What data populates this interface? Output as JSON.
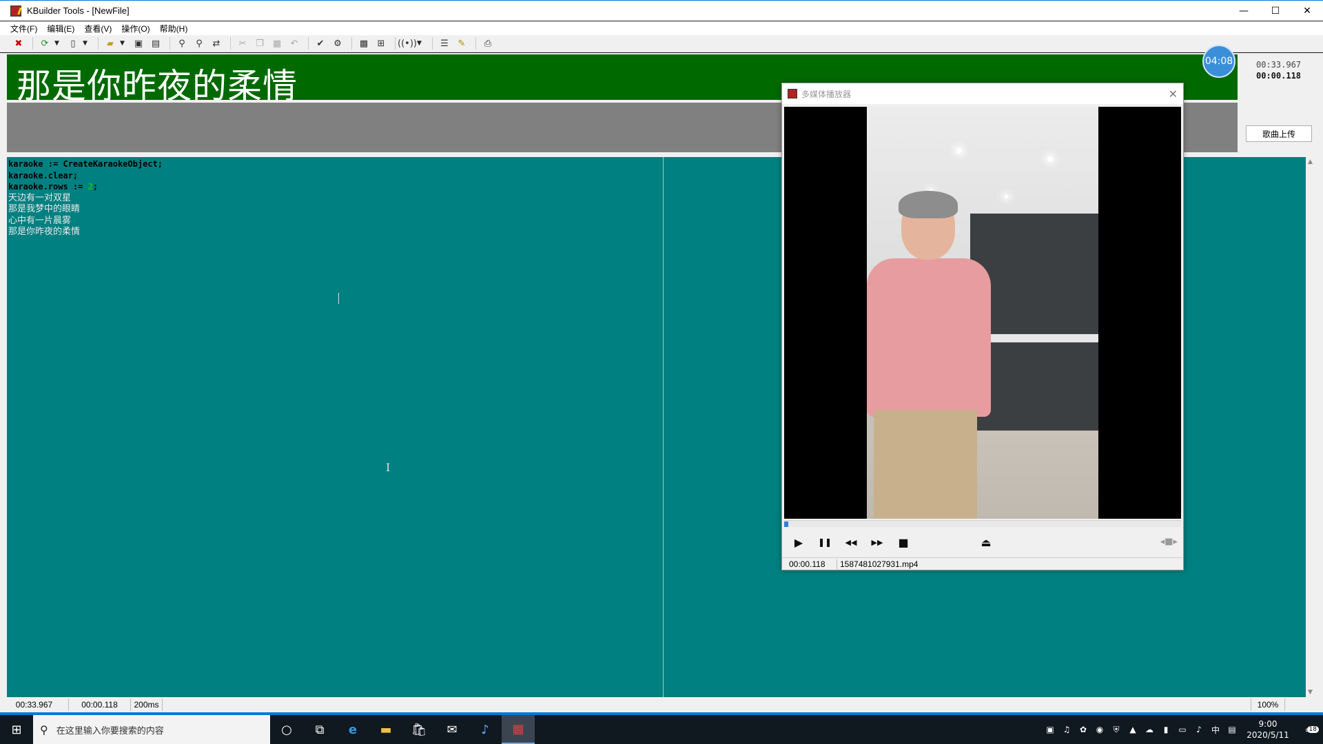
{
  "window": {
    "title": "KBuilder Tools - [NewFile]",
    "controls": {
      "minimize": "—",
      "maximize": "☐",
      "close": "✕"
    }
  },
  "menu": [
    {
      "label": "文件(F)"
    },
    {
      "label": "编辑(E)"
    },
    {
      "label": "查看(V)"
    },
    {
      "label": "操作(O)"
    },
    {
      "label": "帮助(H)"
    }
  ],
  "toolbar": {
    "icons": [
      "exit-icon",
      "refresh-icon",
      "new-file-icon",
      "open-folder-icon",
      "save-icon",
      "save-all-icon",
      "find-icon",
      "find-next-icon",
      "replace-icon",
      "cut-icon",
      "copy-icon",
      "paste-icon",
      "undo-icon",
      "compile-icon",
      "run-icon",
      "preview-icon",
      "record-icon",
      "broadcast-icon",
      "list-icon",
      "settings-icon",
      "export-icon"
    ]
  },
  "lyric_display": {
    "current_line": "那是你昨夜的柔情"
  },
  "timing": {
    "badge": "04:08",
    "position": "00:33.967",
    "offset": "00:00.118"
  },
  "upload_button": "歌曲上传",
  "editor": {
    "code_lines": [
      {
        "text": "karaoke := CreateKaraokeObject;",
        "kind": "kw"
      },
      {
        "text": "karaoke.clear;",
        "kind": "kw"
      },
      {
        "text_pre": "karaoke.rows := ",
        "num": "2",
        "text_post": ";",
        "kind": "mixed"
      },
      {
        "text": "天边有一对双星",
        "kind": "lyric"
      },
      {
        "text": "那是我梦中的眼睛",
        "kind": "lyric"
      },
      {
        "text": "心中有一片晨雾",
        "kind": "lyric"
      },
      {
        "text": "那是你昨夜的柔情",
        "kind": "lyric"
      }
    ]
  },
  "statusbar": {
    "position": "00:33.967",
    "offset": "00:00.118",
    "interval": "200ms",
    "zoom": "100%"
  },
  "player": {
    "title": "多媒体播放器",
    "progress_fraction": 0.01,
    "time": "00:00.118",
    "file": "1587481027931.mp4",
    "buttons": {
      "play": "▶",
      "pause": "❚❚",
      "rewind": "◀◀",
      "forward": "▶▶",
      "stop": "■",
      "eject": "⏏"
    }
  },
  "taskbar": {
    "search_placeholder": "在这里输入你要搜索的内容",
    "clock_time": "9:00",
    "clock_date": "2020/5/11",
    "ime": "中",
    "notifications": "18"
  }
}
